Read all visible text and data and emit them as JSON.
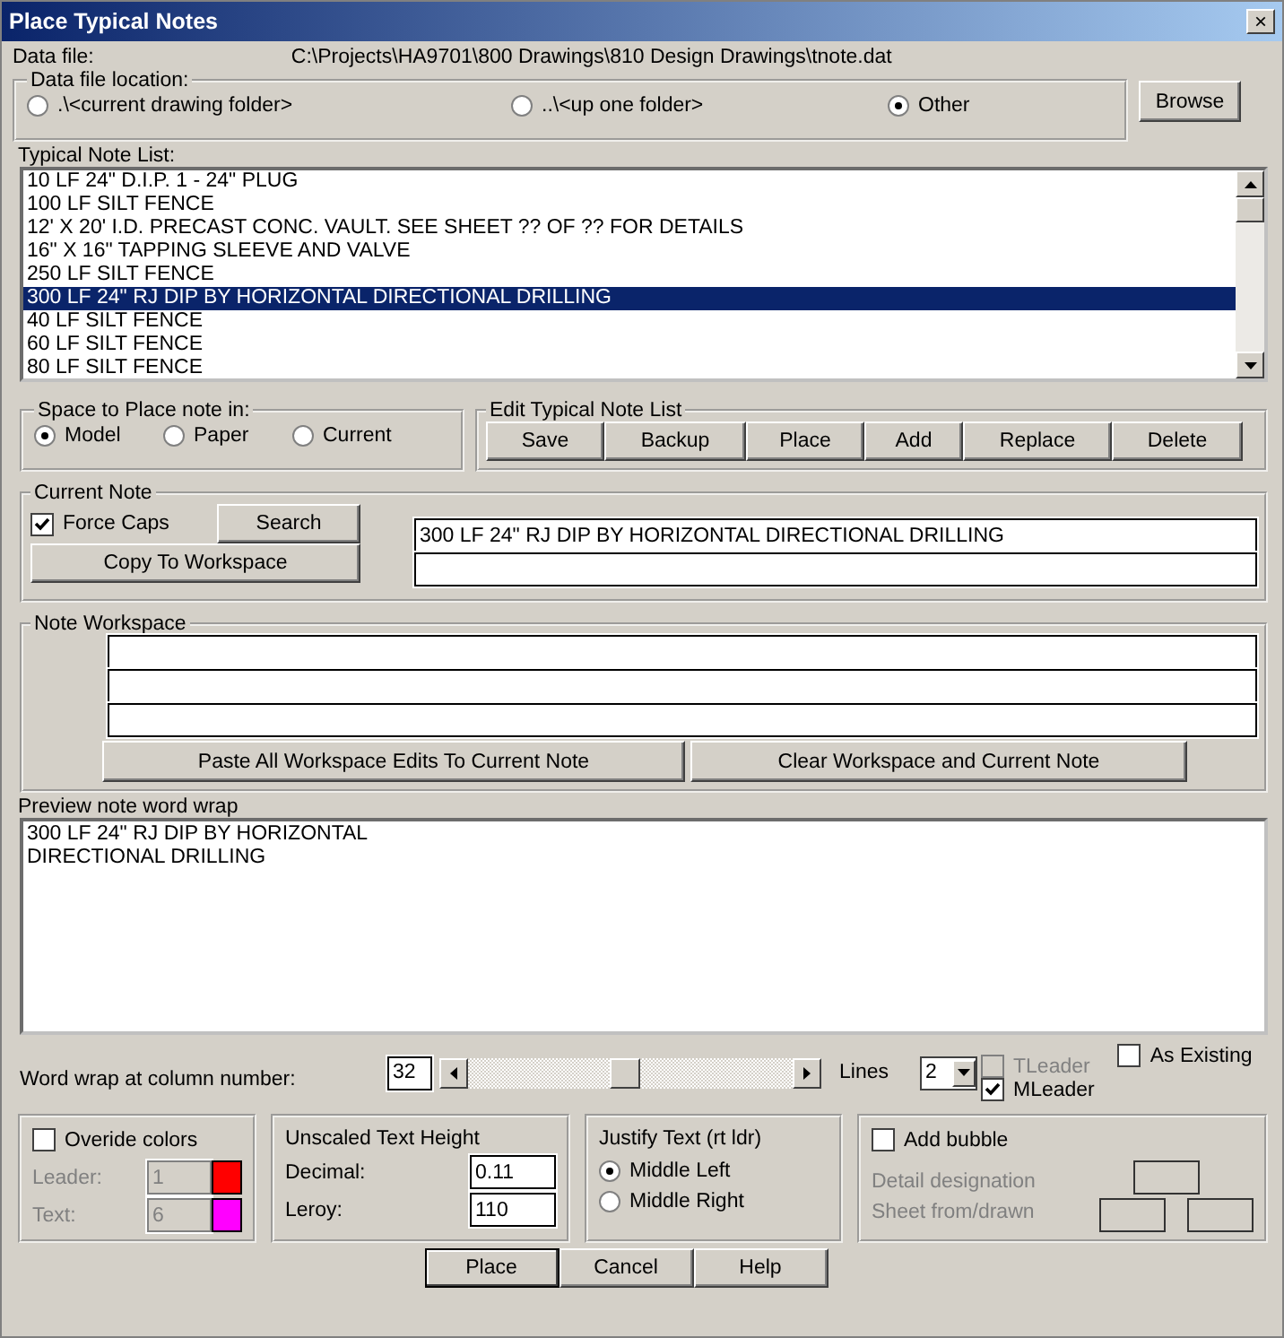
{
  "window": {
    "title": "Place Typical Notes",
    "close": "×"
  },
  "data_file": {
    "label": "Data file:",
    "path": "C:\\Projects\\HA9701\\800 Drawings\\810 Design Drawings\\tnote.dat"
  },
  "data_file_location": {
    "title": "Data file location:",
    "options": [
      {
        "label": ".\\<current drawing folder>",
        "selected": false
      },
      {
        "label": "..\\<up one folder>",
        "selected": false
      },
      {
        "label": "Other",
        "selected": true
      }
    ]
  },
  "browse_button": "Browse",
  "note_list": {
    "label": "Typical Note List:",
    "items": [
      {
        "text": "10 LF 24\" D.I.P. 1 - 24\" PLUG",
        "selected": false
      },
      {
        "text": "100 LF SILT FENCE",
        "selected": false
      },
      {
        "text": "12' X 20' I.D. PRECAST CONC. VAULT. SEE SHEET ?? OF ?? FOR DETAILS",
        "selected": false
      },
      {
        "text": "16\" X 16\" TAPPING SLEEVE AND VALVE",
        "selected": false
      },
      {
        "text": "250 LF SILT FENCE",
        "selected": false
      },
      {
        "text": "300 LF 24\" RJ DIP BY HORIZONTAL DIRECTIONAL DRILLING",
        "selected": true
      },
      {
        "text": "40 LF SILT FENCE",
        "selected": false
      },
      {
        "text": "60 LF SILT FENCE",
        "selected": false
      },
      {
        "text": "80 LF SILT FENCE",
        "selected": false
      }
    ]
  },
  "space": {
    "title": "Space to Place note in:",
    "options": [
      {
        "label": "Model",
        "selected": true
      },
      {
        "label": "Paper",
        "selected": false
      },
      {
        "label": "Current",
        "selected": false
      }
    ]
  },
  "edit_list": {
    "title": "Edit Typical Note List",
    "buttons": [
      "Save",
      "Backup",
      "Place",
      "Add",
      "Replace",
      "Delete"
    ]
  },
  "current_note": {
    "title": "Current Note",
    "force_caps": {
      "label": "Force Caps",
      "checked": true
    },
    "search_button": "Search",
    "copy_button": "Copy To Workspace",
    "value": "300 LF 24\" RJ DIP BY HORIZONTAL DIRECTIONAL DRILLING"
  },
  "workspace": {
    "title": "Note Workspace",
    "paste_button": "Paste All Workspace Edits To Current Note",
    "clear_button": "Clear Workspace and Current Note"
  },
  "preview": {
    "label": "Preview note word wrap",
    "lines": [
      "300 LF 24\" RJ DIP BY HORIZONTAL",
      "DIRECTIONAL DRILLING"
    ]
  },
  "word_wrap": {
    "label": "Word wrap at column number:",
    "value": "32",
    "level": 0.48,
    "lines_label": "Lines",
    "lines_value": "2"
  },
  "leader_options": [
    {
      "label": "TLeader",
      "checked": false,
      "disabled": true
    },
    {
      "label": "MLeader",
      "checked": true,
      "disabled": false
    }
  ],
  "as_existing": {
    "label": "As Existing",
    "checked": false
  },
  "colors": {
    "override": {
      "label": "Overide colors",
      "checked": false
    },
    "rows": [
      {
        "label": "Leader:",
        "value": "1",
        "color": "#ff0000"
      },
      {
        "label": "Text:",
        "value": "6",
        "color": "#ff00ff"
      }
    ]
  },
  "text_height": {
    "title": "Unscaled Text Height",
    "fields": [
      {
        "label": "Decimal:",
        "value": "0.11"
      },
      {
        "label": "Leroy:",
        "value": "110"
      }
    ]
  },
  "justify": {
    "title": "Justify Text (rt ldr)",
    "options": [
      {
        "label": "Middle Left",
        "selected": true
      },
      {
        "label": "Middle Right",
        "selected": false
      }
    ]
  },
  "bubble": {
    "add": {
      "label": "Add bubble",
      "checked": false
    },
    "detail_label": "Detail designation",
    "sheet_label": "Sheet from/drawn"
  },
  "buttons": [
    "Place",
    "Cancel",
    "Help"
  ]
}
